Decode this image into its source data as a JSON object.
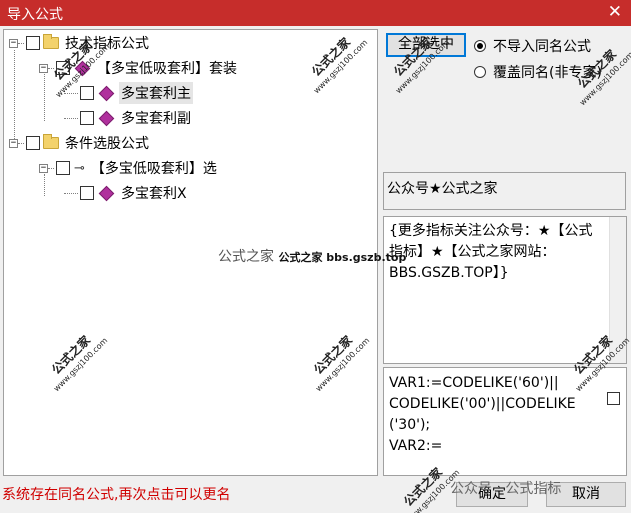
{
  "window": {
    "title": "导入公式",
    "close_glyph": "✕"
  },
  "tree": {
    "nodes": [
      {
        "label": "技术指标公式",
        "type": "folder"
      },
      {
        "label": "【多宝低吸套利】套装",
        "type": "formula"
      },
      {
        "label": "多宝套利主",
        "type": "formula",
        "selected": true
      },
      {
        "label": "多宝套利副",
        "type": "formula"
      },
      {
        "label": "条件选股公式",
        "type": "folder"
      },
      {
        "label": "【多宝低吸套利】选",
        "type": "key"
      },
      {
        "label": "多宝套利X",
        "type": "formula"
      }
    ]
  },
  "buttons": {
    "select_all": "全部选中",
    "ok": "确定",
    "cancel": "取消"
  },
  "options": {
    "skip_same_name": "不导入同名公式",
    "overwrite_same_name": "覆盖同名(非专家)"
  },
  "field_value": "公众号★公式之家",
  "description": "{更多指标关注公众号：★【公式指标】★【公式之家网站：BBS.GSZB.TOP】}",
  "code_lines": [
    "VAR1:=CODELIKE('60')||",
    "CODELIKE('00')||CODELIKE",
    "('30');",
    "VAR2:="
  ],
  "status_message": "系统存在同名公式,再次点击可以更名",
  "watermarks": {
    "stamp_name": "公式之家",
    "stamp_url": "www.gszj100.com",
    "center_text": "公式之家",
    "center_bold": "公式之家 bbs.gszb.top",
    "bottom": "公众号 · 公式指标"
  },
  "colors": {
    "titlebar": "#c62d2b",
    "status": "#d00000"
  }
}
